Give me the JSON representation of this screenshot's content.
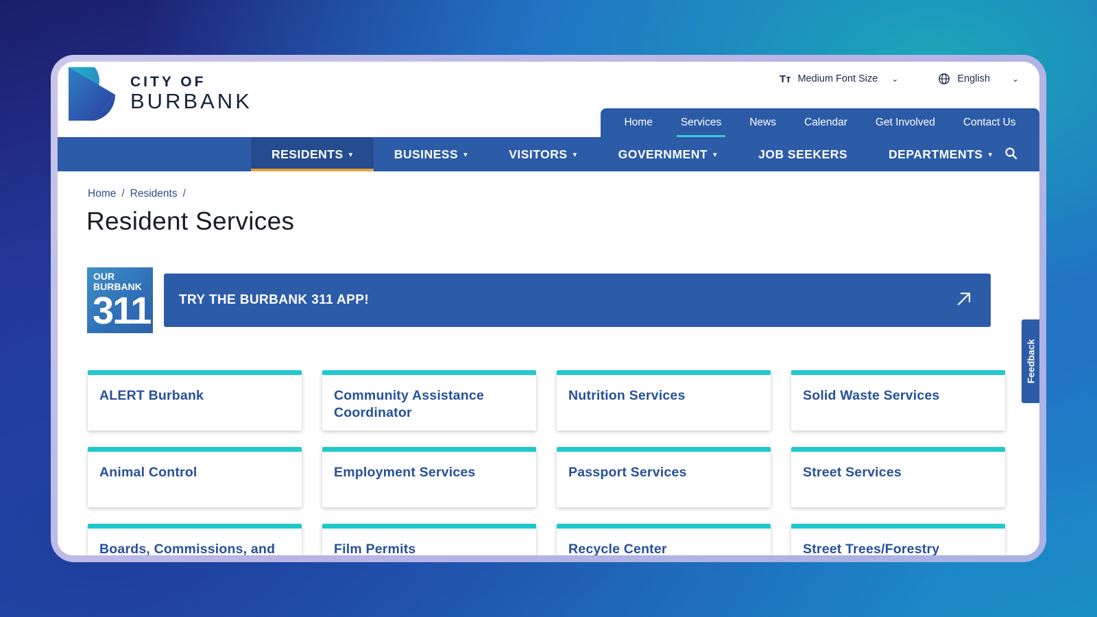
{
  "header": {
    "logo_line1": "CITY OF",
    "logo_line2": "BURBANK",
    "font_size_label": "Medium Font Size",
    "language_label": "English"
  },
  "topnav": [
    "Home",
    "Services",
    "News",
    "Calendar",
    "Get Involved",
    "Contact Us"
  ],
  "topnav_active": "Services",
  "mainnav": {
    "items": [
      "RESIDENTS",
      "BUSINESS",
      "VISITORS",
      "GOVERNMENT",
      "JOB SEEKERS",
      "DEPARTMENTS"
    ],
    "active": "RESIDENTS"
  },
  "breadcrumb": [
    "Home",
    "Residents"
  ],
  "page_title": "Resident Services",
  "badge": {
    "line1": "OUR",
    "line2": "BURBANK",
    "number": "311"
  },
  "cta": {
    "label": "TRY THE BURBANK 311 APP!"
  },
  "cards": [
    "ALERT Burbank",
    "Community Assistance Coordinator",
    "Nutrition Services",
    "Solid Waste Services",
    "Animal Control",
    "Employment Services",
    "Passport Services",
    "Street Services",
    "Boards, Commissions, and",
    "Film Permits",
    "Recycle Center",
    "Street Trees/Forestry"
  ],
  "feedback_label": "Feedback",
  "colors": {
    "brand_blue": "#2c5ba8",
    "accent_teal": "#20c9cf",
    "active_underline": "#e7a23a"
  },
  "icons": {
    "text_size": "text-size-icon",
    "globe": "globe-icon",
    "search": "search-icon",
    "arrow": "external-arrow-icon"
  }
}
